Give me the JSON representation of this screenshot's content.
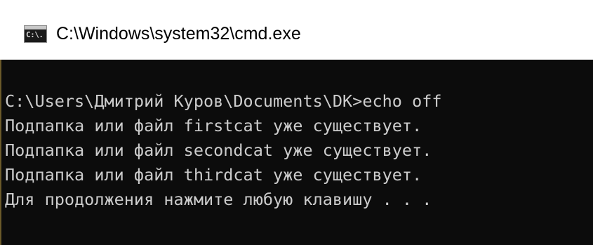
{
  "window": {
    "title": "C:\\Windows\\system32\\cmd.exe",
    "icon": "cmd-console-icon",
    "icon_glyph": "C:\\."
  },
  "console": {
    "lines": [
      "C:\\Users\\Дмитрий Куров\\Documents\\DK>echo off",
      "Подпапка или файл firstcat уже существует.",
      "Подпапка или файл secondcat уже существует.",
      "Подпапка или файл thirdcat уже существует.",
      "Для продолжения нажмите любую клавишу . . ."
    ]
  },
  "colors": {
    "console_background": "#0c0c0c",
    "console_text": "#cccccc",
    "titlebar_background": "#ffffff"
  }
}
